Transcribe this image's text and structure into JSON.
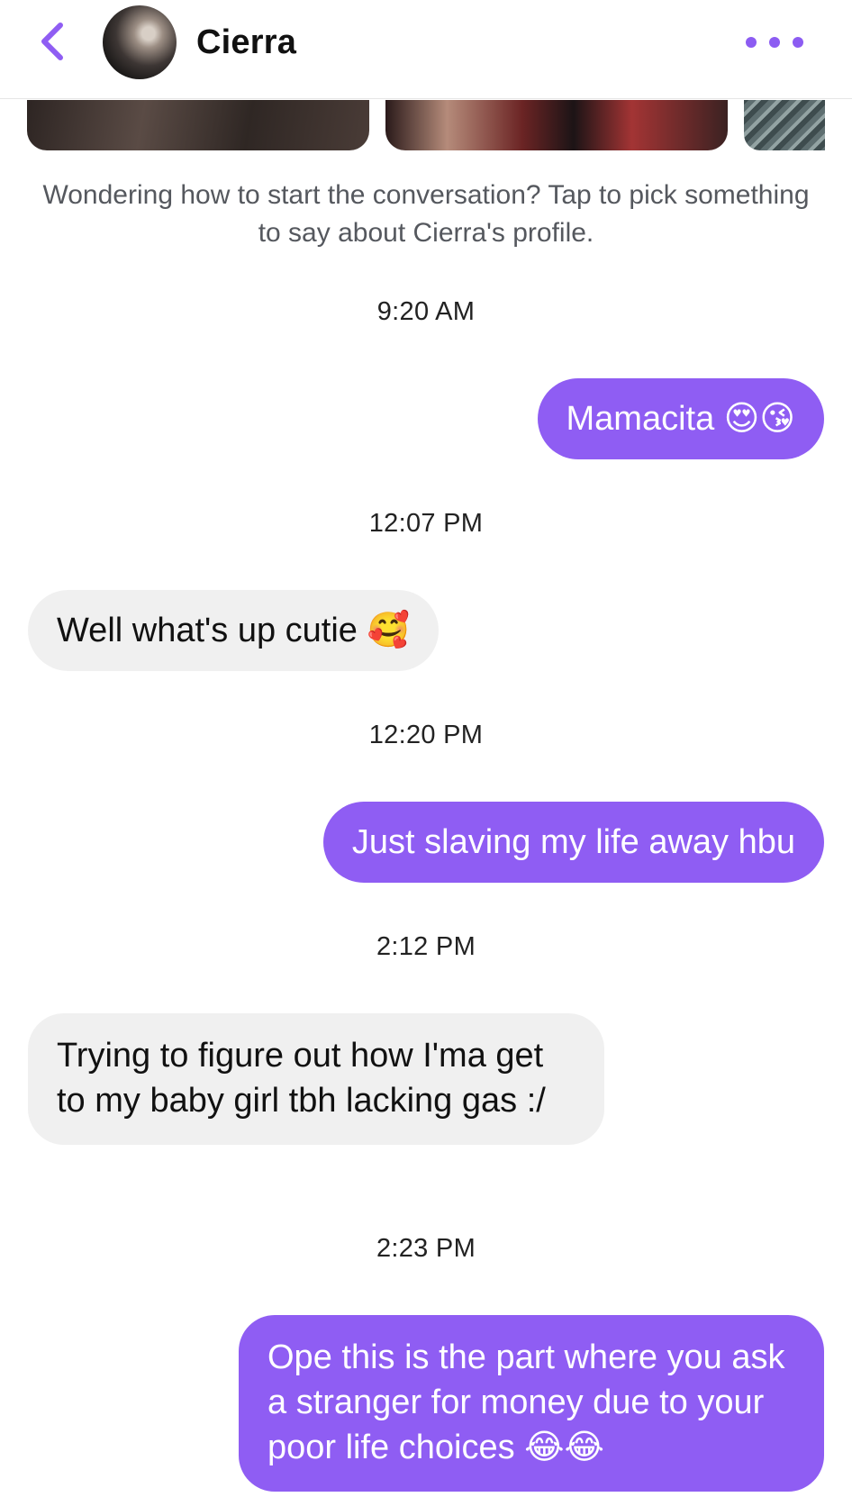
{
  "header": {
    "contact_name": "Cierra",
    "back_icon": "chevron-left-icon",
    "more_icon": "more-horizontal-icon",
    "accent_color": "#8f5df3"
  },
  "prompt_text": "Wondering how to start the conversation? Tap to pick something to say about Cierra's profile.",
  "messages": [
    {
      "timestamp": "9:20 AM",
      "direction": "outgoing",
      "text": "Mamacita 😍😘"
    },
    {
      "timestamp": "12:07 PM",
      "direction": "incoming",
      "text": "Well what's up cutie 🥰"
    },
    {
      "timestamp": "12:20 PM",
      "direction": "outgoing",
      "text": "Just slaving my life away hbu"
    },
    {
      "timestamp": "2:12 PM",
      "direction": "incoming",
      "text": "Trying to figure out how I'ma get to my baby girl tbh lacking gas :/"
    },
    {
      "timestamp": "2:23 PM",
      "direction": "outgoing",
      "text": "Ope this is the part where you ask a stranger for money due to your poor life choices 😂😂"
    }
  ],
  "colors": {
    "outgoing_bubble": "#8f5df3",
    "incoming_bubble": "#f0f0f0"
  }
}
